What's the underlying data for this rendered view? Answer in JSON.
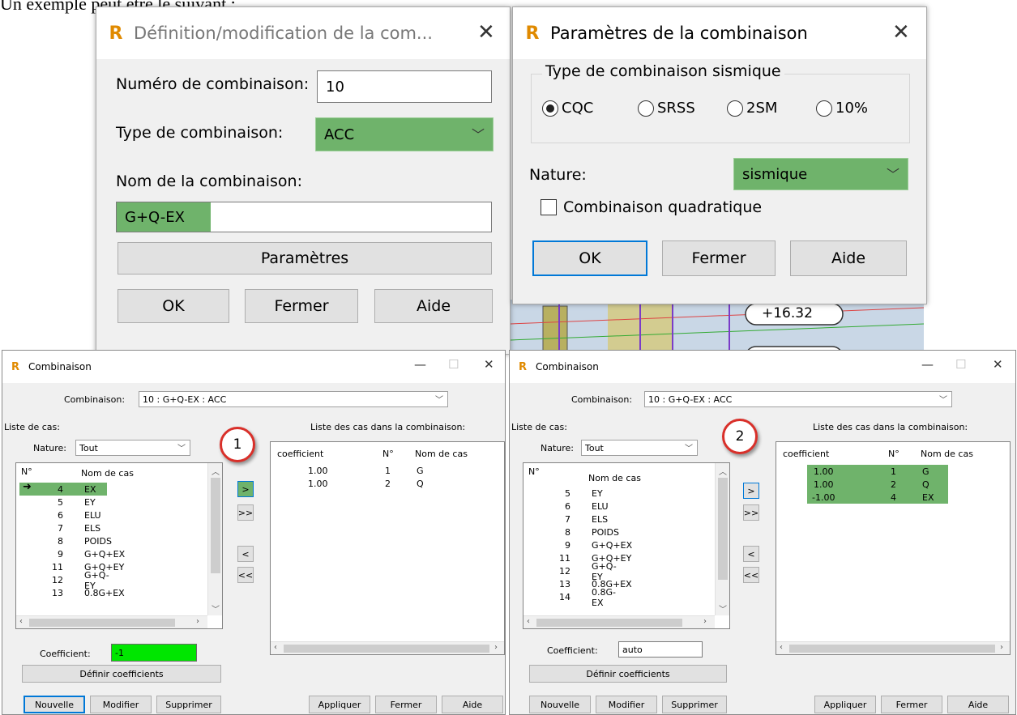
{
  "caption": "Un exemple peut être le suivant :",
  "def_dialog": {
    "title": "Définition/modification de la com...",
    "numero_label": "Numéro de combinaison:",
    "numero_value": "10",
    "type_label": "Type de combinaison:",
    "type_value": "ACC",
    "nom_label": "Nom de la combinaison:",
    "nom_value": "G+Q-EX",
    "parametres_label": "Paramètres",
    "ok_label": "OK",
    "fermer_label": "Fermer",
    "aide_label": "Aide"
  },
  "param_dialog": {
    "title": "Paramètres de la combinaison",
    "group_label": "Type de combinaison sismique",
    "radios": [
      {
        "label": "CQC",
        "checked": true
      },
      {
        "label": "SRSS",
        "checked": false
      },
      {
        "label": "2SM",
        "checked": false
      },
      {
        "label": "10%",
        "checked": false
      }
    ],
    "nature_label": "Nature:",
    "nature_value": "sismique",
    "quadratique_label": "Combinaison quadratique",
    "ok_label": "OK",
    "fermer_label": "Fermer",
    "aide_label": "Aide"
  },
  "scene_label": "+16.32",
  "win1": {
    "title": "Combinaison",
    "combinaison_label": "Combinaison:",
    "combinaison_value": "10 : G+Q-EX : ACC",
    "liste_cas_label": "Liste de cas:",
    "nature_label": "Nature:",
    "nature_value": "Tout",
    "col_no": "N°",
    "col_nom": "Nom de cas",
    "rows": [
      {
        "num": "4",
        "name": "EX"
      },
      {
        "num": "5",
        "name": "EY"
      },
      {
        "num": "6",
        "name": "ELU"
      },
      {
        "num": "7",
        "name": "ELS"
      },
      {
        "num": "8",
        "name": "POIDS"
      },
      {
        "num": "9",
        "name": "G+Q+EX"
      },
      {
        "num": "11",
        "name": "G+Q+EY"
      },
      {
        "num": "12",
        "name": "G+Q-EY"
      },
      {
        "num": "13",
        "name": "0.8G+EX"
      }
    ],
    "coefficient_label": "Coefficient:",
    "coefficient_value": "-1",
    "definir_label": "Définir coefficients",
    "liste_combi_label": "Liste des cas dans la combinaison:",
    "col_coef": "coefficient",
    "combi_rows": [
      {
        "coef": "1.00",
        "num": "1",
        "name": "G"
      },
      {
        "coef": "1.00",
        "num": "2",
        "name": "Q"
      }
    ],
    "move": [
      ">",
      ">>",
      "<",
      "<<"
    ],
    "nouvelle_label": "Nouvelle",
    "modifier_label": "Modifier",
    "supprimer_label": "Supprimer",
    "appliquer_label": "Appliquer",
    "fermer_label": "Fermer",
    "aide_label": "Aide",
    "badge": "1"
  },
  "win2": {
    "title": "Combinaison",
    "combinaison_label": "Combinaison:",
    "combinaison_value": "10 : G+Q-EX : ACC",
    "liste_cas_label": "Liste de cas:",
    "nature_label": "Nature:",
    "nature_value": "Tout",
    "col_no": "N°",
    "col_nom": "Nom de cas",
    "rows": [
      {
        "num": "5",
        "name": "EY"
      },
      {
        "num": "6",
        "name": "ELU"
      },
      {
        "num": "7",
        "name": "ELS"
      },
      {
        "num": "8",
        "name": "POIDS"
      },
      {
        "num": "9",
        "name": "G+Q+EX"
      },
      {
        "num": "11",
        "name": "G+Q+EY"
      },
      {
        "num": "12",
        "name": "G+Q-EY"
      },
      {
        "num": "13",
        "name": "0.8G+EX"
      },
      {
        "num": "14",
        "name": "0.8G-EX"
      }
    ],
    "coefficient_label": "Coefficient:",
    "coefficient_value": "auto",
    "definir_label": "Définir coefficients",
    "liste_combi_label": "Liste des cas dans la combinaison:",
    "col_coef": "coefficient",
    "combi_rows": [
      {
        "coef": "1.00",
        "num": "1",
        "name": "G"
      },
      {
        "coef": "1.00",
        "num": "2",
        "name": "Q"
      },
      {
        "coef": "-1.00",
        "num": "4",
        "name": "EX"
      }
    ],
    "move": [
      ">",
      ">>",
      "<",
      "<<"
    ],
    "nouvelle_label": "Nouvelle",
    "modifier_label": "Modifier",
    "supprimer_label": "Supprimer",
    "appliquer_label": "Appliquer",
    "fermer_label": "Fermer",
    "aide_label": "Aide",
    "badge": "2"
  },
  "colors": {
    "highlight": "#6fb36b",
    "coef_input": "#00e600",
    "badge_border": "#d9302a",
    "default_button": "#0078d7"
  },
  "window_controls": {
    "minimize": "—",
    "maximize": "☐",
    "close": "✕"
  }
}
